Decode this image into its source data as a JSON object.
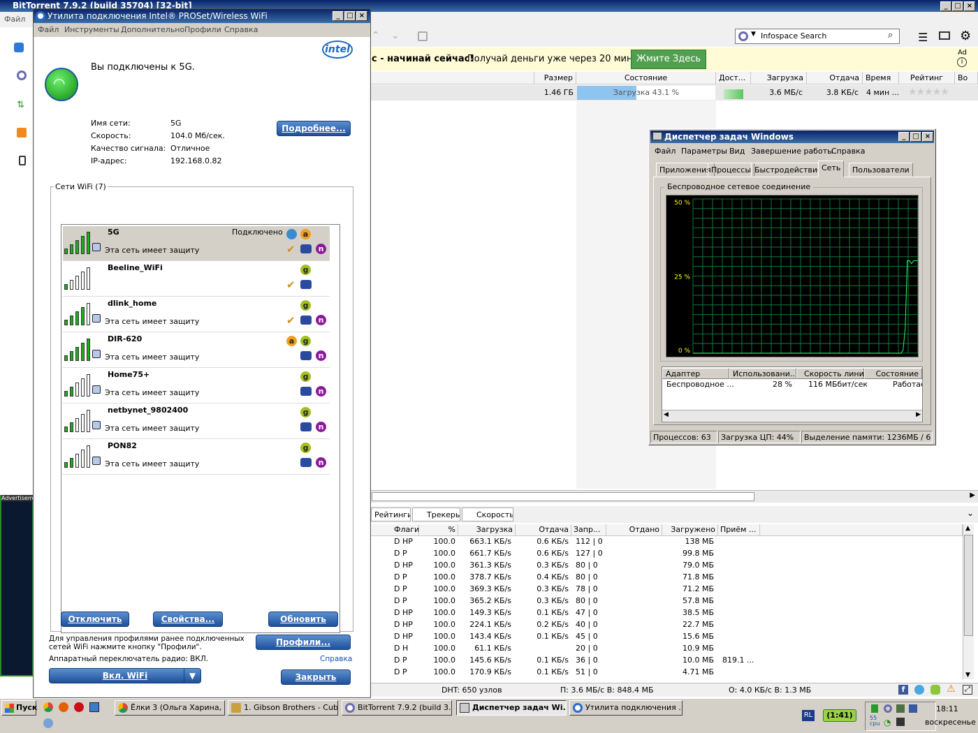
{
  "bt": {
    "title": "BitTorrent 7.9.2  (build 35704) [32-bit]",
    "menu_file": "Файл",
    "search_placeholder": "Infospace Search",
    "ad_text_bold": "с - начинай сейчас!",
    "ad_text": "Получай деньги уже через 20 мин!",
    "ad_button": "Жмите Здесь",
    "ad_label": "Ad",
    "cols": [
      "Размер",
      "Состояние",
      "Дост...",
      "Загрузка",
      "Отдача",
      "Время",
      "Рейтинг",
      "Во"
    ],
    "torrent": {
      "size": "1.46 ГБ",
      "status": "Загрузка 43.1 %",
      "progress": 43.1,
      "down": "3.6 МБ/с",
      "up": "3.8 КБ/с",
      "time": "4 мин ..."
    },
    "tabs": [
      "Рейтинги",
      "Трекеры",
      "Скорость"
    ],
    "peer_cols": [
      "Флаги",
      "%",
      "Загрузка",
      "Отдача",
      "Запр...",
      "Отдано",
      "Загружено",
      "Приём ..."
    ],
    "peers": [
      {
        "flags": "D HP",
        "pct": "100.0",
        "down": "663.1 КБ/s",
        "up": "0.6 КБ/s",
        "req": "112 | 0",
        "got": "138 МБ",
        "recv": ""
      },
      {
        "flags": "D P",
        "pct": "100.0",
        "down": "661.7 КБ/s",
        "up": "0.6 КБ/s",
        "req": "127 | 0",
        "got": "99.8 МБ",
        "recv": ""
      },
      {
        "flags": "D HP",
        "pct": "100.0",
        "down": "361.3 КБ/s",
        "up": "0.3 КБ/s",
        "req": "80 | 0",
        "got": "79.0 МБ",
        "recv": ""
      },
      {
        "flags": "D P",
        "pct": "100.0",
        "down": "378.7 КБ/s",
        "up": "0.4 КБ/s",
        "req": "80 | 0",
        "got": "71.8 МБ",
        "recv": ""
      },
      {
        "flags": "D P",
        "pct": "100.0",
        "down": "369.3 КБ/s",
        "up": "0.3 КБ/s",
        "req": "78 | 0",
        "got": "71.2 МБ",
        "recv": ""
      },
      {
        "flags": "D P",
        "pct": "100.0",
        "down": "365.2 КБ/s",
        "up": "0.3 КБ/s",
        "req": "80 | 0",
        "got": "57.8 МБ",
        "recv": ""
      },
      {
        "flags": "D HP",
        "pct": "100.0",
        "down": "149.3 КБ/s",
        "up": "0.1 КБ/s",
        "req": "47 | 0",
        "got": "38.5 МБ",
        "recv": ""
      },
      {
        "flags": "D HP",
        "pct": "100.0",
        "down": "224.1 КБ/s",
        "up": "0.2 КБ/s",
        "req": "40 | 0",
        "got": "22.7 МБ",
        "recv": ""
      },
      {
        "flags": "D HP",
        "pct": "100.0",
        "down": "143.4 КБ/s",
        "up": "0.1 КБ/s",
        "req": "45 | 0",
        "got": "15.6 МБ",
        "recv": ""
      },
      {
        "flags": "D H",
        "pct": "100.0",
        "down": "61.1 КБ/s",
        "up": "",
        "req": "20 | 0",
        "got": "10.9 МБ",
        "recv": ""
      },
      {
        "flags": "D P",
        "pct": "100.0",
        "down": "145.6 КБ/s",
        "up": "0.1 КБ/s",
        "req": "36 | 0",
        "got": "10.0 МБ",
        "recv": "819.1 ..."
      },
      {
        "flags": "D P",
        "pct": "100.0",
        "down": "170.9 КБ/s",
        "up": "0.1 КБ/s",
        "req": "51 | 0",
        "got": "4.71 МБ",
        "recv": ""
      }
    ],
    "status_dht": "DHT: 650 узлов",
    "status_in": "П: 3.6 МБ/с В: 848.4 МБ",
    "status_out": "О: 4.0 КБ/с В: 1.3 МБ",
    "adv_label": "Advertisement"
  },
  "intel": {
    "title": "Утилита подключения Intel® PROSet/Wireless WiFi",
    "menu": [
      "Файл",
      "Инструменты",
      "Дополнительно",
      "Профили",
      "Справка"
    ],
    "logo": "intel",
    "connected": "Вы подключены к 5G.",
    "info": [
      {
        "k": "Имя сети:",
        "v": "5G"
      },
      {
        "k": "Скорость:",
        "v": "104.0 Мб/сек."
      },
      {
        "k": "Качество сигнала:",
        "v": "Отличное"
      },
      {
        "k": "IP-адрес:",
        "v": "192.168.0.82"
      }
    ],
    "details_btn": "Подробнее...",
    "group_label": "Сети WiFi (7)",
    "networks": [
      {
        "name": "5G",
        "status": "Подключено",
        "desc": "Эта сеть имеет защиту",
        "signal": 5,
        "lock": true
      },
      {
        "name": "Beeline_WiFi",
        "status": "",
        "desc": "",
        "signal": 1,
        "lock": false
      },
      {
        "name": "dlink_home",
        "status": "",
        "desc": "Эта сеть имеет защиту",
        "signal": 4,
        "lock": true
      },
      {
        "name": "DIR-620",
        "status": "",
        "desc": "Эта сеть имеет защиту",
        "signal": 5,
        "lock": true
      },
      {
        "name": "Home75+",
        "status": "",
        "desc": "Эта сеть имеет защиту",
        "signal": 2,
        "lock": true
      },
      {
        "name": "netbynet_9802400",
        "status": "",
        "desc": "Эта сеть имеет защиту",
        "signal": 2,
        "lock": true
      },
      {
        "name": "PON82",
        "status": "",
        "desc": "Эта сеть имеет защиту",
        "signal": 2,
        "lock": true
      }
    ],
    "btn_disconnect": "Отключить",
    "btn_props": "Свойства...",
    "btn_refresh": "Обновить",
    "profiles_text": "Для управления профилями ранее подключенных сетей WiFi нажмите кнопку \"Профили\".",
    "btn_profiles": "Профили...",
    "radio_text": "Аппаратный переключатель радио: ВКЛ.",
    "help_link": "Справка",
    "btn_wifi": "Вкл. WiFi",
    "btn_close": "Закрыть"
  },
  "tm": {
    "title": "Диспетчер задач Windows",
    "menu": [
      "Файл",
      "Параметры",
      "Вид",
      "Завершение работы",
      "Справка"
    ],
    "tabs": [
      "Приложения",
      "Процессы",
      "Быстродействие",
      "Сеть",
      "Пользователи"
    ],
    "group_label": "Беспроводное сетевое соединение",
    "y_labels": [
      "50 %",
      "25 %",
      "0 %"
    ],
    "graph_values": [
      0,
      0,
      0,
      0,
      0,
      0,
      0,
      0,
      0,
      0,
      0,
      0,
      0,
      0,
      0,
      0,
      0,
      0,
      0,
      0,
      0,
      0,
      0,
      0,
      0,
      0,
      0,
      0,
      0,
      0,
      0,
      0,
      0,
      0,
      0,
      0,
      0,
      0,
      0,
      0,
      0,
      0,
      0,
      0,
      0,
      0,
      0,
      0,
      0,
      0,
      0,
      0,
      0,
      0,
      0,
      0,
      0,
      0,
      0,
      0,
      0,
      0,
      0,
      0,
      0,
      0,
      0,
      0,
      0,
      0,
      0,
      0,
      0,
      0,
      0,
      0,
      0,
      0,
      0,
      0,
      0,
      0,
      0,
      0,
      0,
      0,
      0,
      0,
      0,
      0,
      0,
      0,
      0,
      0,
      0,
      0,
      0,
      0,
      0,
      1,
      8,
      30,
      30,
      29,
      30,
      30,
      30
    ],
    "adapter_cols": [
      "Адаптер",
      "Использовани...",
      "Скорость линии",
      "Состояние"
    ],
    "adapter_row": [
      "Беспроводное ...",
      "28 %",
      "116 МБбит/сек",
      "Работае"
    ],
    "st_proc": "Процессов: 63",
    "st_cpu": "Загрузка ЦП: 44%",
    "st_mem": "Выделение памяти: 1236МБ / 6"
  },
  "taskbar": {
    "start": "Пуск",
    "items": [
      "Ёлки 3 (Ольга Харина, ...",
      "1. Gibson Brothers - Cub...",
      "BitTorrent 7.9.2  (build 3...",
      "Диспетчер задач Wi...",
      "Утилита подключения ..."
    ],
    "lang": "RL",
    "timer": "(1:41)",
    "cpu": "55 cpu",
    "time": "18:11",
    "day": "воскресенье"
  }
}
